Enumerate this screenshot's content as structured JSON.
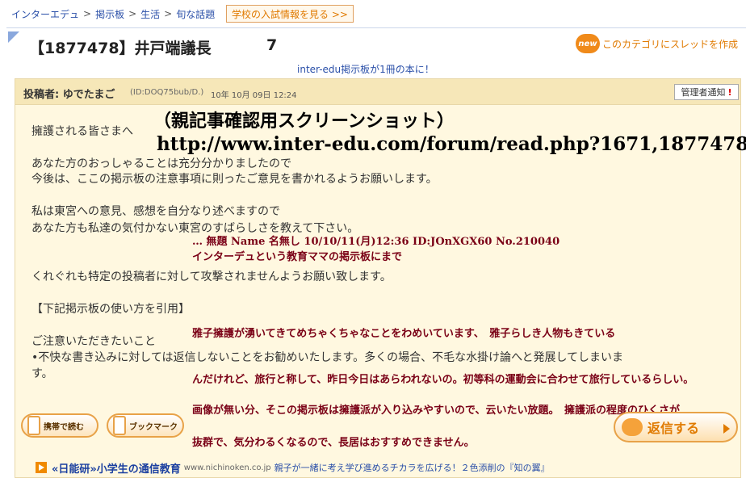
{
  "breadcrumb": [
    "インターエデュ",
    "掲示板",
    "生活",
    "旬な話題"
  ],
  "school_button": "学校の入試情報を見る >>",
  "thread": {
    "title": "【1877478】井戸端議長",
    "count": "7",
    "new_badge": "new",
    "new_thread_label": "このカテゴリにスレッドを作成"
  },
  "book_link": "inter-edu掲示板が1冊の本に！",
  "post": {
    "poster_label": "投稿者: ゆでたまご",
    "poster_id": "(ID:DOQ75bub/D.)",
    "date": "10年 10月 09日 12:24",
    "admin_button": "管理者通知",
    "lines": [
      "擁護される皆さまへ",
      "あなた方のおっしゃることは充分分かりましたので",
      "今後は、ここの掲示板の注意事項に則ったご意見を書かれるようお願いします。",
      "私は東宮への意見、感想を自分なり述べますので",
      "あなた方も私達の気付かない東宮のすばらしさを教えて下さい。",
      "くれぐれも特定の投稿者に対して攻撃されませんようお願い致します。",
      "【下記掲示板の使い方を引用】",
      "ご注意いただきたいこと",
      "•不快な書き込みに対しては返信しないことをお勧めいたします。多くの場合、不毛な水掛け論へと発展してしまいま",
      "す。"
    ]
  },
  "overlay": {
    "heading": "（親記事確認用スクリーンショット）",
    "url": "http://www.inter-edu.com/forum/read.php?1671,1877478",
    "quote_header": "… 無題 Name 名無し 10/10/11(月)12:36 ID:JOnXGX60 No.210040",
    "quote_line": "インターデュという教育ママの掲示板にまで",
    "comment_lines": [
      "雅子擁護が湧いてきてめちゃくちゃなことをわめいています、　雅子らしき人物もきている",
      "んだけれど、旅行と称して、昨日今日はあらわれないの。初等科の運動会に合わせて旅行しているらしい。",
      "画像が無い分、そこの掲示板は擁護派が入り込みやすいので、云いたい放題。　擁護派の程度のひくさが",
      "抜群で、気分わるくなるので、長居はおすすめできません。"
    ]
  },
  "buttons": {
    "mobile": "携帯で読む",
    "bookmark": "ブックマーク",
    "reply": "返信する"
  },
  "ad": {
    "title": "«日能研»小学生の通信教育",
    "url": "www.nichinoken.co.jp",
    "desc": "親子が一緒に考え学び進めるチカラを広げる！２色添削の『知の翼』"
  },
  "colors": {
    "link": "#2a4fa8",
    "accent_orange": "#e07a00",
    "post_bg": "#fff8e0",
    "post_header_bg": "#f6e7b8",
    "overlay_red": "#7a0016"
  },
  "icons": [
    "new-badge-icon",
    "mobile-phone-icon",
    "bookmark-icon",
    "speech-bubble-icon",
    "play-arrow-icon",
    "exclamation-icon"
  ]
}
